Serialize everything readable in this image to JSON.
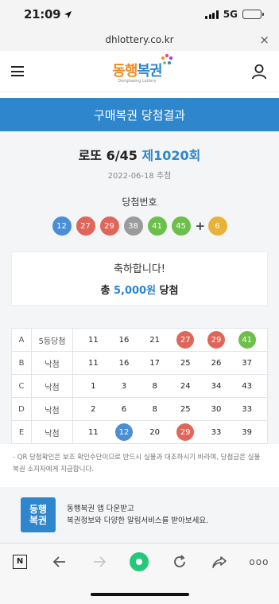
{
  "status": {
    "time": "21:09",
    "network": "5G"
  },
  "browser": {
    "url": "dhlottery.co.kr",
    "close_glyph": "×"
  },
  "header": {
    "logo_main_1": "동행",
    "logo_main_2": "복권",
    "logo_sub": "Donghaeng Lottery"
  },
  "banner": {
    "title": "구매복권 당첨결과"
  },
  "draw": {
    "name": "로또 6/45",
    "round": "제1020회",
    "date": "2022-06-18 추첨",
    "win_label": "당첨번호",
    "numbers": [
      "12",
      "27",
      "29",
      "38",
      "41",
      "45"
    ],
    "number_colors": [
      "#4a8fd6",
      "#e0665a",
      "#e0665a",
      "#9b9b9b",
      "#6cbf4a",
      "#6cbf4a"
    ],
    "plus": "+",
    "bonus": "6",
    "bonus_color": "#e6b23a"
  },
  "congrats": {
    "line1": "축하합니다!",
    "prefix": "총 ",
    "amount": "5,000원",
    "suffix": " 당첨"
  },
  "tickets": [
    {
      "game": "A",
      "rank": "5등당첨",
      "nums": [
        "11",
        "16",
        "21",
        "27",
        "29",
        "41"
      ],
      "hits": [
        false,
        false,
        false,
        true,
        true,
        true
      ],
      "hit_colors": [
        "",
        "",
        "",
        "#e0665a",
        "#e0665a",
        "#6cbf4a"
      ]
    },
    {
      "game": "B",
      "rank": "낙첨",
      "nums": [
        "11",
        "16",
        "17",
        "25",
        "26",
        "37"
      ],
      "hits": [
        false,
        false,
        false,
        false,
        false,
        false
      ],
      "hit_colors": [
        "",
        "",
        "",
        "",
        "",
        ""
      ]
    },
    {
      "game": "C",
      "rank": "낙첨",
      "nums": [
        "1",
        "3",
        "8",
        "24",
        "34",
        "43"
      ],
      "hits": [
        false,
        false,
        false,
        false,
        false,
        false
      ],
      "hit_colors": [
        "",
        "",
        "",
        "",
        "",
        ""
      ]
    },
    {
      "game": "D",
      "rank": "낙첨",
      "nums": [
        "2",
        "6",
        "8",
        "25",
        "30",
        "33"
      ],
      "hits": [
        false,
        false,
        false,
        false,
        false,
        false
      ],
      "hit_colors": [
        "",
        "",
        "",
        "",
        "",
        ""
      ]
    },
    {
      "game": "E",
      "rank": "낙첨",
      "nums": [
        "11",
        "12",
        "20",
        "29",
        "33",
        "39"
      ],
      "hits": [
        false,
        true,
        false,
        true,
        false,
        false
      ],
      "hit_colors": [
        "",
        "#4a8fd6",
        "",
        "#e0665a",
        "",
        ""
      ]
    }
  ],
  "note": "- QR 당첨확인은 보조 확인수단이므로 반드시 실물과 대조하시기 바라며, 당첨금은 실물 복권 소지자에게 지급합니다.",
  "app_promo": {
    "logo_1": "동행",
    "logo_2": "복권",
    "line1": "동행복권 앱 다운받고",
    "line2": "복권정보와 다양한 알림서비스를 받아보세요."
  },
  "toolbar": {
    "n_label": "N",
    "more": "ooo"
  }
}
